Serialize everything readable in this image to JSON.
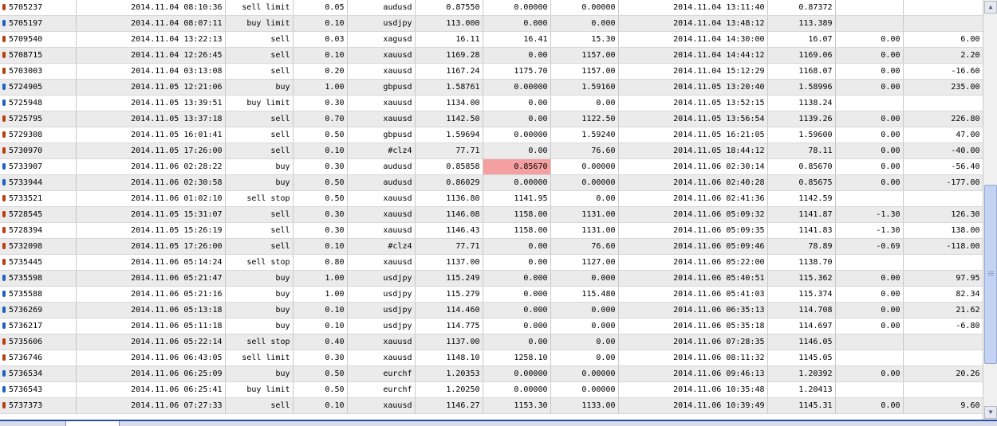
{
  "table": {
    "rows": [
      {
        "ticket": "5705237",
        "open_time": "2014.11.04 08:10:36",
        "type": "sell limit",
        "size": "0.05",
        "symbol": "audusd",
        "price": "0.87550",
        "sl": "0.00000",
        "tp": "0.00000",
        "close_time": "2014.11.04 13:11:40",
        "close_price": "0.87372",
        "swap": "",
        "profit": ""
      },
      {
        "ticket": "5705197",
        "open_time": "2014.11.04 08:07:11",
        "type": "buy limit",
        "size": "0.10",
        "symbol": "usdjpy",
        "price": "113.000",
        "sl": "0.000",
        "tp": "0.000",
        "close_time": "2014.11.04 13:48:12",
        "close_price": "113.389",
        "swap": "",
        "profit": ""
      },
      {
        "ticket": "5709540",
        "open_time": "2014.11.04 13:22:13",
        "type": "sell",
        "size": "0.03",
        "symbol": "xagusd",
        "price": "16.11",
        "sl": "16.41",
        "tp": "15.30",
        "close_time": "2014.11.04 14:30:00",
        "close_price": "16.07",
        "swap": "0.00",
        "profit": "6.00"
      },
      {
        "ticket": "5708715",
        "open_time": "2014.11.04 12:26:45",
        "type": "sell",
        "size": "0.10",
        "symbol": "xauusd",
        "price": "1169.28",
        "sl": "0.00",
        "tp": "1157.00",
        "close_time": "2014.11.04 14:44:12",
        "close_price": "1169.06",
        "swap": "0.00",
        "profit": "2.20"
      },
      {
        "ticket": "5703003",
        "open_time": "2014.11.04 03:13:08",
        "type": "sell",
        "size": "0.20",
        "symbol": "xauusd",
        "price": "1167.24",
        "sl": "1175.70",
        "tp": "1157.00",
        "close_time": "2014.11.04 15:12:29",
        "close_price": "1168.07",
        "swap": "0.00",
        "profit": "-16.60"
      },
      {
        "ticket": "5724905",
        "open_time": "2014.11.05 12:21:06",
        "type": "buy",
        "size": "1.00",
        "symbol": "gbpusd",
        "price": "1.58761",
        "sl": "0.00000",
        "tp": "1.59160",
        "close_time": "2014.11.05 13:20:40",
        "close_price": "1.58996",
        "swap": "0.00",
        "profit": "235.00"
      },
      {
        "ticket": "5725948",
        "open_time": "2014.11.05 13:39:51",
        "type": "buy limit",
        "size": "0.30",
        "symbol": "xauusd",
        "price": "1134.00",
        "sl": "0.00",
        "tp": "0.00",
        "close_time": "2014.11.05 13:52:15",
        "close_price": "1138.24",
        "swap": "",
        "profit": ""
      },
      {
        "ticket": "5725795",
        "open_time": "2014.11.05 13:37:18",
        "type": "sell",
        "size": "0.70",
        "symbol": "xauusd",
        "price": "1142.50",
        "sl": "0.00",
        "tp": "1122.50",
        "close_time": "2014.11.05 13:56:54",
        "close_price": "1139.26",
        "swap": "0.00",
        "profit": "226.80"
      },
      {
        "ticket": "5729308",
        "open_time": "2014.11.05 16:01:41",
        "type": "sell",
        "size": "0.50",
        "symbol": "gbpusd",
        "price": "1.59694",
        "sl": "0.00000",
        "tp": "1.59240",
        "close_time": "2014.11.05 16:21:05",
        "close_price": "1.59600",
        "swap": "0.00",
        "profit": "47.00"
      },
      {
        "ticket": "5730970",
        "open_time": "2014.11.05 17:26:00",
        "type": "sell",
        "size": "0.10",
        "symbol": "#clz4",
        "price": "77.71",
        "sl": "0.00",
        "tp": "76.60",
        "close_time": "2014.11.05 18:44:12",
        "close_price": "78.11",
        "swap": "0.00",
        "profit": "-40.00"
      },
      {
        "ticket": "5733907",
        "open_time": "2014.11.06 02:28:22",
        "type": "buy",
        "size": "0.30",
        "symbol": "audusd",
        "price": "0.85858",
        "sl": "0.85670",
        "tp": "0.00000",
        "close_time": "2014.11.06 02:30:14",
        "close_price": "0.85670",
        "swap": "0.00",
        "profit": "-56.40",
        "hl": true
      },
      {
        "ticket": "5733944",
        "open_time": "2014.11.06 02:30:58",
        "type": "buy",
        "size": "0.50",
        "symbol": "audusd",
        "price": "0.86029",
        "sl": "0.00000",
        "tp": "0.00000",
        "close_time": "2014.11.06 02:40:28",
        "close_price": "0.85675",
        "swap": "0.00",
        "profit": "-177.00"
      },
      {
        "ticket": "5733521",
        "open_time": "2014.11.06 01:02:10",
        "type": "sell stop",
        "size": "0.50",
        "symbol": "xauusd",
        "price": "1136.80",
        "sl": "1141.95",
        "tp": "0.00",
        "close_time": "2014.11.06 02:41:36",
        "close_price": "1142.59",
        "swap": "",
        "profit": ""
      },
      {
        "ticket": "5728545",
        "open_time": "2014.11.05 15:31:07",
        "type": "sell",
        "size": "0.30",
        "symbol": "xauusd",
        "price": "1146.08",
        "sl": "1158.00",
        "tp": "1131.00",
        "close_time": "2014.11.06 05:09:32",
        "close_price": "1141.87",
        "swap": "-1.30",
        "profit": "126.30"
      },
      {
        "ticket": "5728394",
        "open_time": "2014.11.05 15:26:19",
        "type": "sell",
        "size": "0.30",
        "symbol": "xauusd",
        "price": "1146.43",
        "sl": "1158.00",
        "tp": "1131.00",
        "close_time": "2014.11.06 05:09:35",
        "close_price": "1141.83",
        "swap": "-1.30",
        "profit": "138.00"
      },
      {
        "ticket": "5732098",
        "open_time": "2014.11.05 17:26:00",
        "type": "sell",
        "size": "0.10",
        "symbol": "#clz4",
        "price": "77.71",
        "sl": "0.00",
        "tp": "76.60",
        "close_time": "2014.11.06 05:09:46",
        "close_price": "78.89",
        "swap": "-0.69",
        "profit": "-118.00"
      },
      {
        "ticket": "5735445",
        "open_time": "2014.11.06 05:14:24",
        "type": "sell stop",
        "size": "0.80",
        "symbol": "xauusd",
        "price": "1137.00",
        "sl": "0.00",
        "tp": "1127.00",
        "close_time": "2014.11.06 05:22:00",
        "close_price": "1138.70",
        "swap": "",
        "profit": ""
      },
      {
        "ticket": "5735598",
        "open_time": "2014.11.06 05:21:47",
        "type": "buy",
        "size": "1.00",
        "symbol": "usdjpy",
        "price": "115.249",
        "sl": "0.000",
        "tp": "0.000",
        "close_time": "2014.11.06 05:40:51",
        "close_price": "115.362",
        "swap": "0.00",
        "profit": "97.95"
      },
      {
        "ticket": "5735588",
        "open_time": "2014.11.06 05:21:16",
        "type": "buy",
        "size": "1.00",
        "symbol": "usdjpy",
        "price": "115.279",
        "sl": "0.000",
        "tp": "115.480",
        "close_time": "2014.11.06 05:41:03",
        "close_price": "115.374",
        "swap": "0.00",
        "profit": "82.34"
      },
      {
        "ticket": "5736269",
        "open_time": "2014.11.06 05:13:18",
        "type": "buy",
        "size": "0.10",
        "symbol": "usdjpy",
        "price": "114.460",
        "sl": "0.000",
        "tp": "0.000",
        "close_time": "2014.11.06 06:35:13",
        "close_price": "114.708",
        "swap": "0.00",
        "profit": "21.62"
      },
      {
        "ticket": "5736217",
        "open_time": "2014.11.06 05:11:18",
        "type": "buy",
        "size": "0.10",
        "symbol": "usdjpy",
        "price": "114.775",
        "sl": "0.000",
        "tp": "0.000",
        "close_time": "2014.11.06 05:35:18",
        "close_price": "114.697",
        "swap": "0.00",
        "profit": "-6.80"
      },
      {
        "ticket": "5735606",
        "open_time": "2014.11.06 05:22:14",
        "type": "sell stop",
        "size": "0.40",
        "symbol": "xauusd",
        "price": "1137.00",
        "sl": "0.00",
        "tp": "0.00",
        "close_time": "2014.11.06 07:28:35",
        "close_price": "1146.05",
        "swap": "",
        "profit": ""
      },
      {
        "ticket": "5736746",
        "open_time": "2014.11.06 06:43:05",
        "type": "sell limit",
        "size": "0.30",
        "symbol": "xauusd",
        "price": "1148.10",
        "sl": "1258.10",
        "tp": "0.00",
        "close_time": "2014.11.06 08:11:32",
        "close_price": "1145.05",
        "swap": "",
        "profit": ""
      },
      {
        "ticket": "5736534",
        "open_time": "2014.11.06 06:25:09",
        "type": "buy",
        "size": "0.50",
        "symbol": "eurchf",
        "price": "1.20353",
        "sl": "0.00000",
        "tp": "0.00000",
        "close_time": "2014.11.06 09:46:13",
        "close_price": "1.20392",
        "swap": "0.00",
        "profit": "20.26"
      },
      {
        "ticket": "5736543",
        "open_time": "2014.11.06 06:25:41",
        "type": "buy limit",
        "size": "0.50",
        "symbol": "eurchf",
        "price": "1.20250",
        "sl": "0.00000",
        "tp": "0.00000",
        "close_time": "2014.11.06 10:35:48",
        "close_price": "1.20413",
        "swap": "",
        "profit": ""
      },
      {
        "ticket": "5737373",
        "open_time": "2014.11.06 07:27:33",
        "type": "sell",
        "size": "0.10",
        "symbol": "xauusd",
        "price": "1146.27",
        "sl": "1153.30",
        "tp": "1133.00",
        "close_time": "2014.11.06 10:39:49",
        "close_price": "1145.31",
        "swap": "0.00",
        "profit": "9.60"
      }
    ]
  },
  "scrollbar": {
    "up_icon": "arrow-up-icon",
    "down_icon": "arrow-down-icon",
    "thumb_position": 0.62
  },
  "tabs": [
    {
      "label": "",
      "active": false
    },
    {
      "label": "",
      "active": true
    }
  ],
  "colors": {
    "row_alt": "#ebebeb",
    "highlight": "#f4a0a0",
    "tab_border": "#2a4ea6"
  }
}
